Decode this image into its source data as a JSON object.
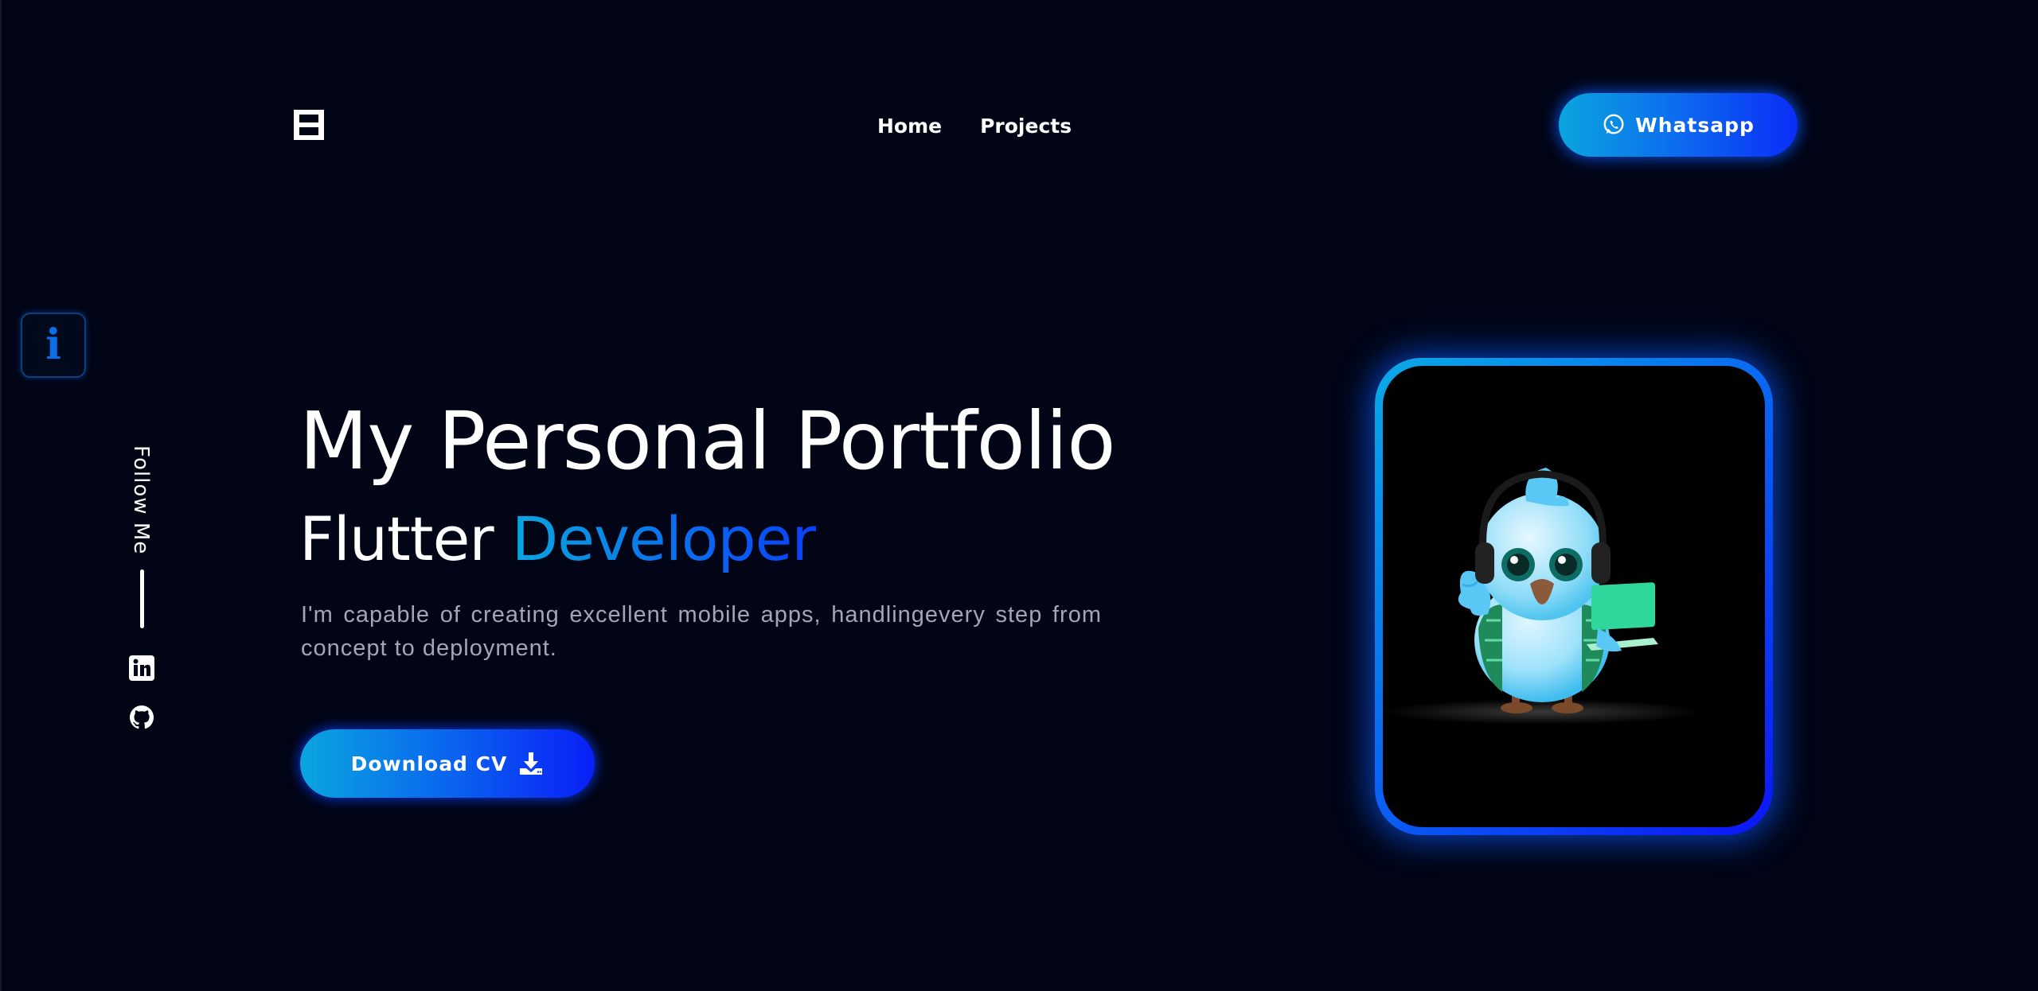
{
  "header": {
    "nav": [
      {
        "label": "Home"
      },
      {
        "label": "Projects"
      }
    ],
    "whatsapp_label": "Whatsapp"
  },
  "sidebar": {
    "info_label": "i",
    "follow_label": "Follow Me",
    "social_icons": [
      "linkedin-icon",
      "github-icon"
    ]
  },
  "hero": {
    "title": "My Personal Portfolio",
    "subtitle_prefix": "Flutter",
    "subtitle_accent": "Developer",
    "description": "I'm capable of creating excellent mobile apps, handlingevery step from concept to deployment.",
    "cv_label": "Download CV"
  },
  "colors": {
    "background": "#010516",
    "accent_start": "#0aa6df",
    "accent_end": "#0a1ef8",
    "muted_text": "#a3a6b4"
  }
}
